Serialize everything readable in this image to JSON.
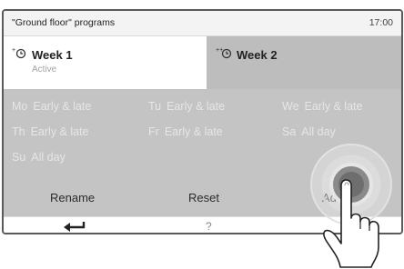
{
  "header": {
    "title": "\"Ground floor\" programs",
    "time": "17:00"
  },
  "tabs": [
    {
      "label": "Week 1",
      "sublabel": "Active",
      "icon": "clock-icon",
      "active": true
    },
    {
      "label": "Week 2",
      "icon": "clock-icon",
      "active": false
    }
  ],
  "schedule": [
    [
      {
        "day": "Mo",
        "program": "Early & late"
      },
      {
        "day": "Tu",
        "program": "Early & late"
      },
      {
        "day": "We",
        "program": "Early & late"
      }
    ],
    [
      {
        "day": "Th",
        "program": "Early & late"
      },
      {
        "day": "Fr",
        "program": "Early & late"
      },
      {
        "day": "Sa",
        "program": "All day"
      }
    ],
    [
      {
        "day": "Su",
        "program": "All day"
      }
    ]
  ],
  "actions": {
    "rename": "Rename",
    "reset": "Reset",
    "adopt": "Adopt"
  },
  "nav": {
    "back_icon": "back-arrow-icon",
    "help": "?"
  },
  "colors": {
    "panel": "#c4c4c4",
    "tab_inactive": "#bdbdbd",
    "text_faded": "#e6e6e6"
  }
}
